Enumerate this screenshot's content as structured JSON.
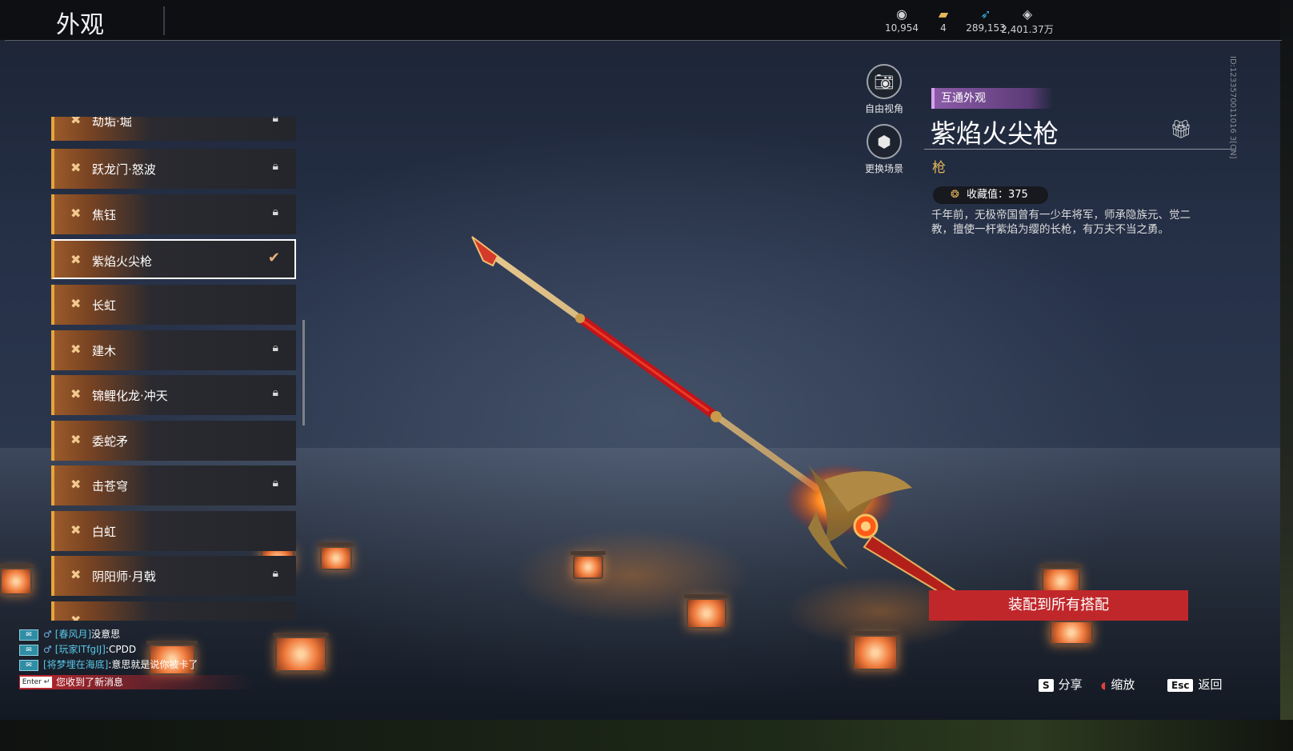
{
  "header": {
    "title": "外观"
  },
  "currencies": [
    {
      "icon": "coin-icon",
      "value": "10,954"
    },
    {
      "icon": "ticket-icon",
      "value": "4"
    },
    {
      "icon": "feather-icon",
      "value": "289,153"
    },
    {
      "icon": "diamond-icon",
      "value": "2,401.37万"
    }
  ],
  "skin_list": {
    "items": [
      {
        "label": "劫垢·堀",
        "locked": true
      },
      {
        "label": "跃龙门·怒波",
        "locked": true
      },
      {
        "label": "焦钰",
        "locked": true
      },
      {
        "label": "紫焰火尖枪",
        "locked": false,
        "selected": true
      },
      {
        "label": "长虹",
        "locked": false
      },
      {
        "label": "建木",
        "locked": true
      },
      {
        "label": "锦鲤化龙·冲天",
        "locked": true
      },
      {
        "label": "委蛇矛",
        "locked": false
      },
      {
        "label": "击苍穹",
        "locked": true
      },
      {
        "label": "白虹",
        "locked": false
      },
      {
        "label": "阴阳师·月戟",
        "locked": true
      }
    ]
  },
  "view_controls": {
    "free_camera": "自由视角",
    "change_scene": "更换场景"
  },
  "detail": {
    "tag": "互通外观",
    "name": "紫焰火尖枪",
    "type": "枪",
    "collect_label": "收藏值：375",
    "description": "千年前，无极帝国曾有一少年将军，师承隐族元、觉二教，擅使一杆紫焰为缨的长枪，有万夫不当之勇。",
    "id_text": "ID:1233570011016 3[CN]"
  },
  "equip_button": "装配到所有搭配",
  "chat": {
    "messages": [
      {
        "name": "[春风月]",
        "text": "没意思"
      },
      {
        "name": "[玩家ITfgIJ]",
        "text": ":CPDD"
      },
      {
        "name": "[将梦埋在海底]",
        "text": ":意思就是说你被卡了"
      }
    ],
    "enter_key": "Enter ↵",
    "notice": "您收到了新消息"
  },
  "hints": [
    {
      "key": "S",
      "label": "分享"
    },
    {
      "key": "◖",
      "label": "缩放"
    },
    {
      "key": "Esc",
      "label": "返回"
    }
  ],
  "colors": {
    "accent_orange": "#e7a43b",
    "equip_red": "#c0272b",
    "tag_purple": "#8b5ba7",
    "type_gold": "#e6b65a"
  }
}
